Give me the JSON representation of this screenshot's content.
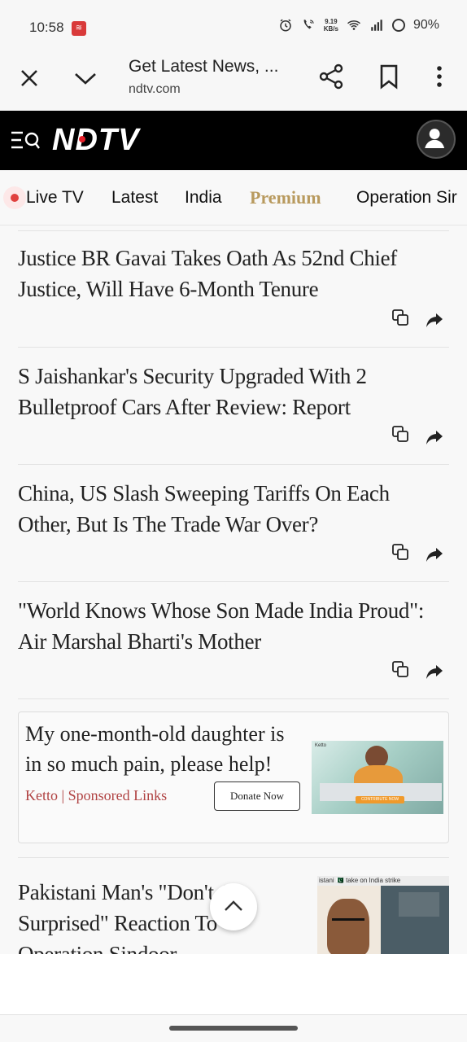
{
  "status_bar": {
    "time": "10:58",
    "network_speed_value": "9.19",
    "network_speed_unit": "KB/s",
    "battery": "90%",
    "icons": [
      "alarm-icon",
      "wifi-call-icon",
      "wifi-icon",
      "signal-icon",
      "battery-icon"
    ]
  },
  "custom_tab": {
    "title": "Get Latest News, ...",
    "url": "ndtv.com",
    "icons": [
      "close-icon",
      "chevron-down-icon",
      "share-icon",
      "bookmark-icon",
      "more-vert-icon"
    ]
  },
  "header": {
    "logo_text": "NDTV",
    "colors": {
      "background": "#000000",
      "logo_dot": "#e8202a"
    }
  },
  "nav": {
    "items": [
      {
        "label": "Live TV",
        "live": true
      },
      {
        "label": "Latest"
      },
      {
        "label": "India"
      },
      {
        "label": "Premium",
        "accent": "#b89a5e"
      },
      {
        "label": "Operation Sir"
      }
    ]
  },
  "articles": [
    {
      "headline": "Justice BR Gavai Takes Oath As 52nd Chief Justice, Will Have 6-Month Tenure"
    },
    {
      "headline": "S Jaishankar's Security Upgraded With 2 Bulletproof Cars After Review: Report"
    },
    {
      "headline": "China, US Slash Sweeping Tariffs On Each Other, But Is The Trade War Over?"
    },
    {
      "headline": "\"World Knows Whose Son Made India Proud\": Air Marshal Bharti's Mother"
    }
  ],
  "sponsored": {
    "title": "My one-month-old daughter is in so much pain, please help!",
    "source": "Ketto | Sponsored Links",
    "button": "Donate Now",
    "image_brand": "Ketto",
    "image_cta": "CONTRIBUTE NOW"
  },
  "last_article": {
    "headline_line1": "Pakistani Man's \"Don't Act",
    "headline_line2": "Surprised\" Reaction To",
    "headline_line3": "Operation Sindoor",
    "thumb_caption": "istani 🇵🇰 take on India strike"
  }
}
